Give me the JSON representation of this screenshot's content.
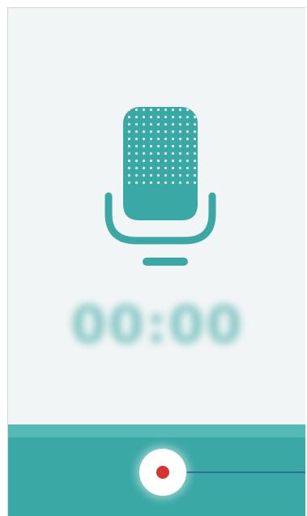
{
  "recorder": {
    "timer_text": "00:00"
  },
  "colors": {
    "accent": "#3aa8a5",
    "accent_light": "#55b9b6",
    "background": "#f2f5f5",
    "record_dot": "#d9322f",
    "callout": "#2f6f9e"
  },
  "icons": {
    "microphone": "microphone-icon",
    "record": "record-dot-icon"
  }
}
